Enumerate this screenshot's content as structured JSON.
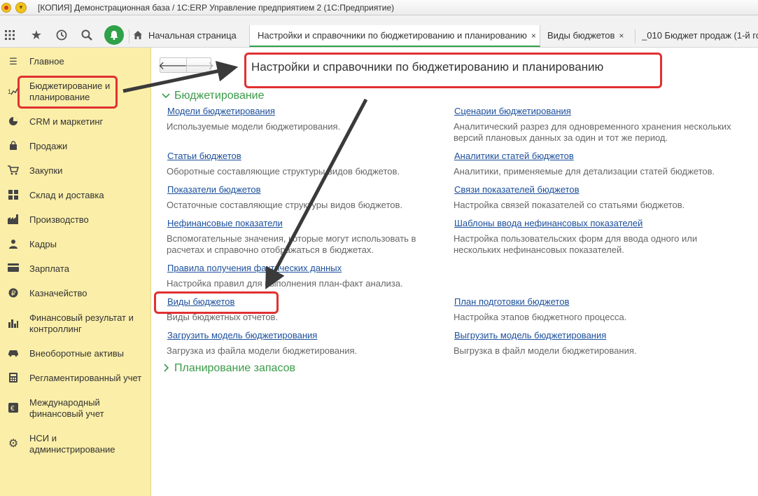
{
  "window": {
    "title": "[КОПИЯ] Демонстрационная база / 1С:ERP Управление предприятием 2  (1С:Предприятие)"
  },
  "toolbar": {
    "icons": [
      "apps-icon",
      "star-icon",
      "history-icon",
      "search-icon",
      "bell-icon"
    ],
    "tabs": [
      {
        "label": "Начальная страница"
      },
      {
        "label": "Настройки и справочники по бюджетированию и планированию",
        "close": "×"
      },
      {
        "label": "Виды  бюджетов",
        "close": "×"
      },
      {
        "label": "_010 Бюджет продаж (1-й го"
      }
    ]
  },
  "sidebar": {
    "items": [
      {
        "label": "Главное",
        "icon": "menu-icon"
      },
      {
        "label": "Бюджетирование и планирование",
        "icon": "budget-icon"
      },
      {
        "label": "CRM и маркетинг",
        "icon": "pie-chart-icon"
      },
      {
        "label": "Продажи",
        "icon": "bag-icon"
      },
      {
        "label": "Закупки",
        "icon": "cart-icon"
      },
      {
        "label": "Склад и доставка",
        "icon": "warehouse-icon"
      },
      {
        "label": "Производство",
        "icon": "factory-icon"
      },
      {
        "label": "Кадры",
        "icon": "person-icon"
      },
      {
        "label": "Зарплата",
        "icon": "card-icon"
      },
      {
        "label": "Казначейство",
        "icon": "coin-icon"
      },
      {
        "label": "Финансовый результат и контроллинг",
        "icon": "bar-chart-icon"
      },
      {
        "label": "Внеоборотные активы",
        "icon": "car-icon"
      },
      {
        "label": "Регламентированный учет",
        "icon": "calculator-icon"
      },
      {
        "label": "Международный финансовый учет",
        "icon": "euro-icon"
      },
      {
        "label": "НСИ и администрирование",
        "icon": "gear-icon"
      }
    ]
  },
  "main": {
    "title": "Настройки и справочники по бюджетированию и планированию",
    "groups": [
      {
        "title": "Бюджетирование",
        "expanded": true
      },
      {
        "title": "Планирование запасов",
        "expanded": false
      }
    ],
    "left": [
      {
        "link": "Модели бюджетирования",
        "desc": "Используемые модели бюджетирования."
      },
      {
        "link": "Статьи бюджетов",
        "desc": "Оборотные составляющие структуры видов бюджетов."
      },
      {
        "link": "Показатели бюджетов",
        "desc": "Остаточные составляющие структуры видов бюджетов."
      },
      {
        "link": "Нефинансовые показатели",
        "desc": "Вспомогательные значения, которые могут использовать в расчетах и справочно отображаться в бюджетах."
      },
      {
        "link": "Правила получения фактических данных",
        "desc": "Настройка правил для выполнения план-факт анализа."
      },
      {
        "link": "Виды бюджетов",
        "desc": "Виды бюджетных отчетов."
      },
      {
        "link": "Загрузить модель бюджетирования",
        "desc": "Загрузка из файла модели бюджетирования."
      }
    ],
    "right": [
      {
        "link": "Сценарии бюджетирования",
        "desc": "Аналитический разрез для одновременного хранения нескольких версий плановых данных за один и тот же период."
      },
      {
        "link": "Аналитики статей бюджетов",
        "desc": "Аналитики, применяемые для детализации статей бюджетов."
      },
      {
        "link": "Связи показателей бюджетов",
        "desc": "Настройка связей показателей со статьями бюджетов."
      },
      {
        "link": "Шаблоны ввода нефинансовых показателей",
        "desc": "Настройка пользовательских форм для ввода одного или нескольких нефинансовых показателей."
      },
      {
        "link": "План подготовки бюджетов",
        "desc": "Настройка этапов бюджетного процесса."
      },
      {
        "link": "Выгрузить модель бюджетирования",
        "desc": "Выгрузка в файл модели бюджетирования."
      }
    ]
  },
  "colors": {
    "sidebar_bg": "#fbeea8",
    "link": "#1b4f9c",
    "group": "#3b9b48",
    "highlight": "#e03131"
  }
}
